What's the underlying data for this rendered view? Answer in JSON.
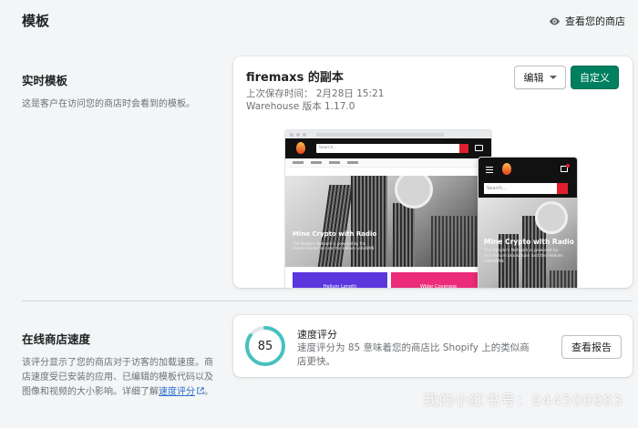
{
  "header": {
    "title": "模板",
    "view_store": "查看您的商店",
    "view_store_icon": "eye-icon"
  },
  "live_theme": {
    "section_title": "实时模板",
    "section_desc": "这是客户在访问您的商店时会看到的模板。",
    "name": "firemaxs 的副本",
    "last_saved": "上次保存时间： 2月28日 15:21",
    "version": "Warehouse 版本 1.17.0",
    "edit_label": "编辑",
    "customize_label": "自定义",
    "preview": {
      "desktop_search_placeholder": "Search...",
      "desktop_hero_title": "Mine Crypto with Radio",
      "desktop_hero_sub": "The People's Network is powered by the Helium blockchain and the Helium LoRaWAN",
      "tile_1": "Helium Length",
      "tile_2": "Wider Coverage",
      "mobile_search_placeholder": "Search...",
      "mobile_hero_title": "Mine Crypto with Radio",
      "mobile_hero_sub": "The People's Network is powered by the Helium blockchain and the Helium LoRaWAN"
    }
  },
  "speed": {
    "section_title": "在线商店速度",
    "section_desc": "该评分显示了您的商店对于访客的加载速度。商店速度受已安装的应用、已编辑的模板代码以及图像和视频的大小影响。详细了解",
    "section_link": "速度评分",
    "section_link_icon": "external-link-icon",
    "section_tail": "。",
    "score": "85",
    "score_fraction": 0.85,
    "label": "速度评分",
    "text": "速度评分为 85 意味着您的商店比 Shopify 上的类似商店更快。",
    "report_label": "查看报告"
  },
  "watermark": "我的小红书号：944500983",
  "colors": {
    "primary": "#008060",
    "ring": "#47c1bf",
    "accent_red": "#e01f2e"
  }
}
